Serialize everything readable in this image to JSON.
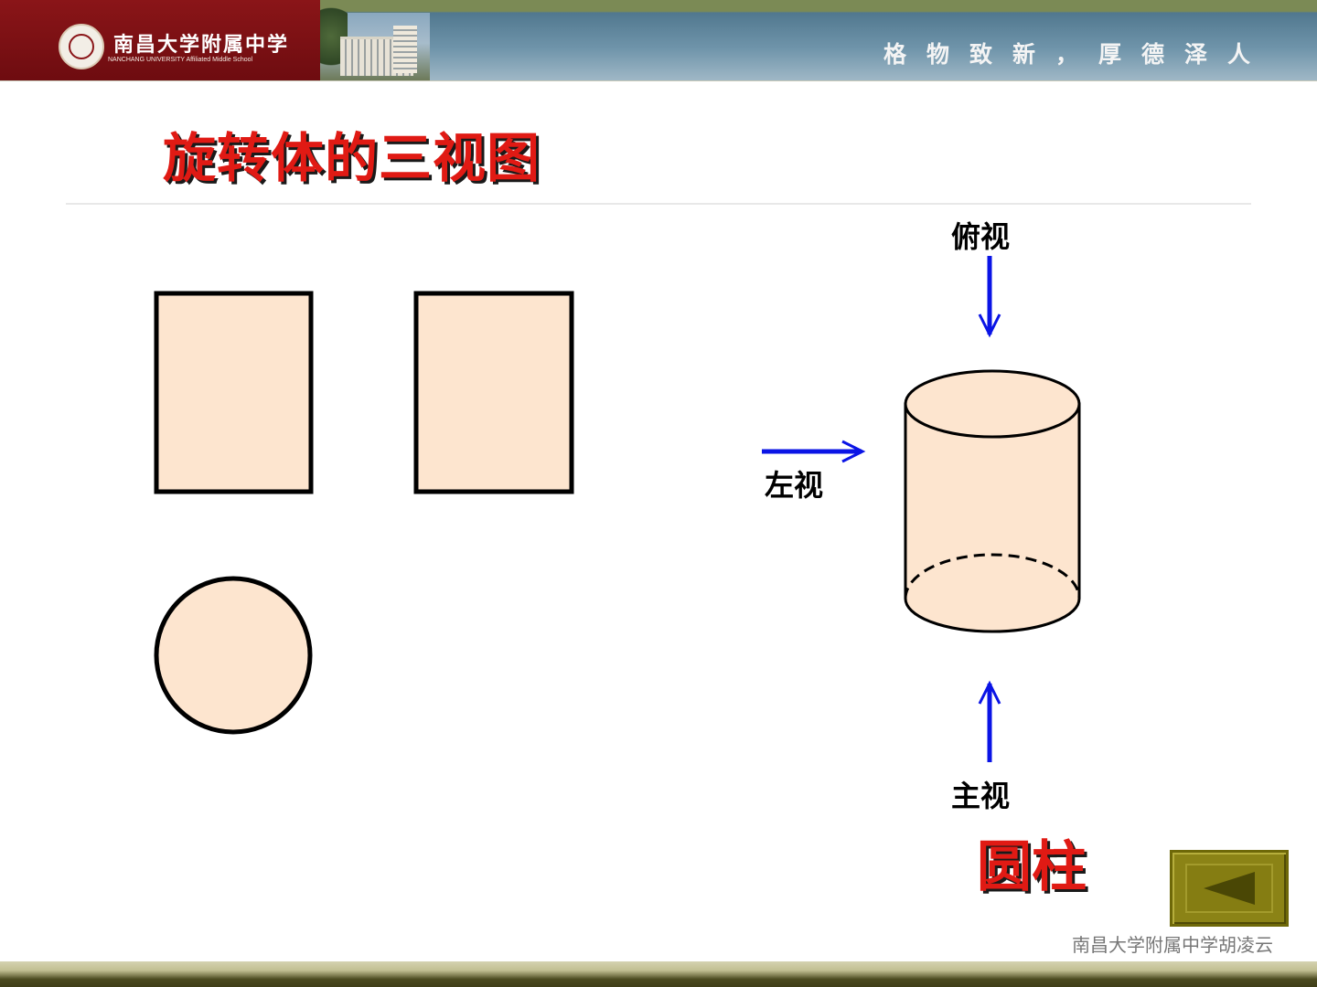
{
  "header": {
    "school_name": "南昌大学附属中学",
    "school_name_en": "NANCHANG UNIVERSITY Affiliated Middle School",
    "motto": "格物致新，厚德泽人"
  },
  "slide": {
    "title": "旋转体的三视图",
    "shape_name": "圆柱",
    "labels": {
      "top_view": "俯视",
      "left_view": "左视",
      "front_view": "主视"
    }
  },
  "colors": {
    "title_red": "#e01a14",
    "shape_fill": "#fde5cf",
    "arrow_blue": "#0a14e6",
    "nav_olive": "#8b8316"
  },
  "footer": {
    "credit": "南昌大学附属中学胡凌云"
  },
  "nav": {
    "back_icon": "triangle-left-icon"
  }
}
